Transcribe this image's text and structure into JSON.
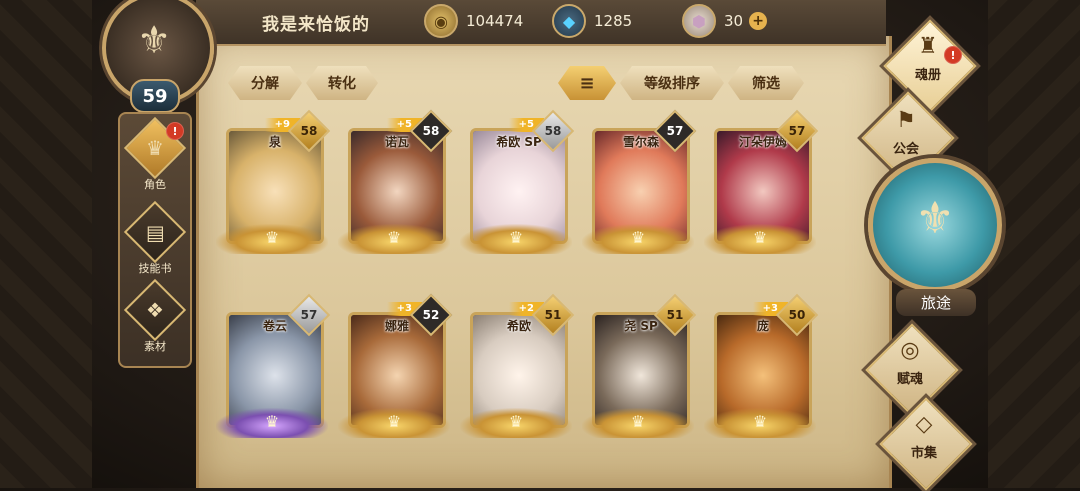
{
  "header": {
    "player_name": "我是来恰饭的",
    "player_level": "59",
    "resources": {
      "gold": "104474",
      "crystal": "1285",
      "gem": "30",
      "gem_add": "+"
    }
  },
  "sidebar": {
    "items": [
      {
        "label": "角色",
        "badge": "!"
      },
      {
        "label": "技能书"
      },
      {
        "label": "素材"
      }
    ]
  },
  "toolbar": {
    "decompose": "分解",
    "convert": "转化",
    "sort_icon": "≡",
    "sort_level": "等级排序",
    "filter": "筛选"
  },
  "cards": [
    {
      "name": "泉",
      "level": "58",
      "plus": "+9"
    },
    {
      "name": "诺瓦",
      "level": "58",
      "plus": "+5"
    },
    {
      "name": "希欧 SP",
      "level": "58",
      "plus": "+5"
    },
    {
      "name": "雪尔森",
      "level": "57",
      "plus": ""
    },
    {
      "name": "汀朵伊姆",
      "level": "57",
      "plus": ""
    },
    {
      "name": "卷云",
      "level": "57",
      "plus": ""
    },
    {
      "name": "娜雅",
      "level": "52",
      "plus": "+3"
    },
    {
      "name": "希欧",
      "level": "51",
      "plus": "+2"
    },
    {
      "name": "尧 SP",
      "level": "51",
      "plus": ""
    },
    {
      "name": "庞",
      "level": "50",
      "plus": "+3"
    }
  ],
  "right_nav": {
    "soul_book": "魂册",
    "soul_book_badge": "!",
    "guild": "公会",
    "journey": "旅途",
    "talent": "赋魂",
    "market": "市集"
  }
}
